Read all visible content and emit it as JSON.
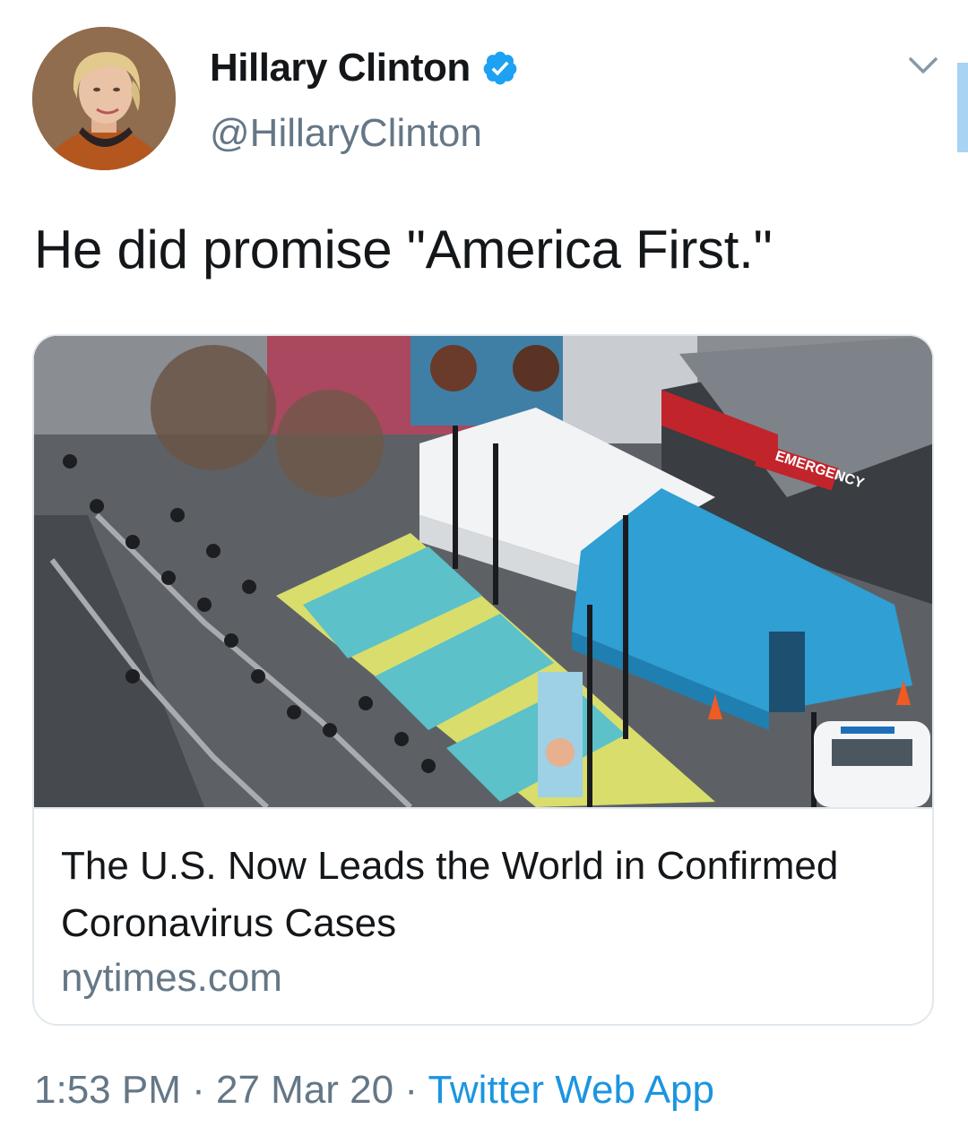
{
  "author": {
    "name": "Hillary Clinton",
    "handle": "@HillaryClinton",
    "verified": true,
    "verified_color": "#1da1f2"
  },
  "tweet": {
    "text": "He did promise \"America First.\""
  },
  "card": {
    "title": "The U.S. Now Leads the World in Confirmed Coronavirus Cases",
    "domain": "nytimes.com",
    "image_signs": {
      "emergency": "EMERGENCY"
    }
  },
  "meta": {
    "time": "1:53 PM",
    "separator": "·",
    "date": "27 Mar 20",
    "source": "Twitter Web App",
    "source_color": "#1b95e0"
  },
  "icons": {
    "verified": "verified-badge-icon",
    "menu": "chevron-down-icon"
  }
}
